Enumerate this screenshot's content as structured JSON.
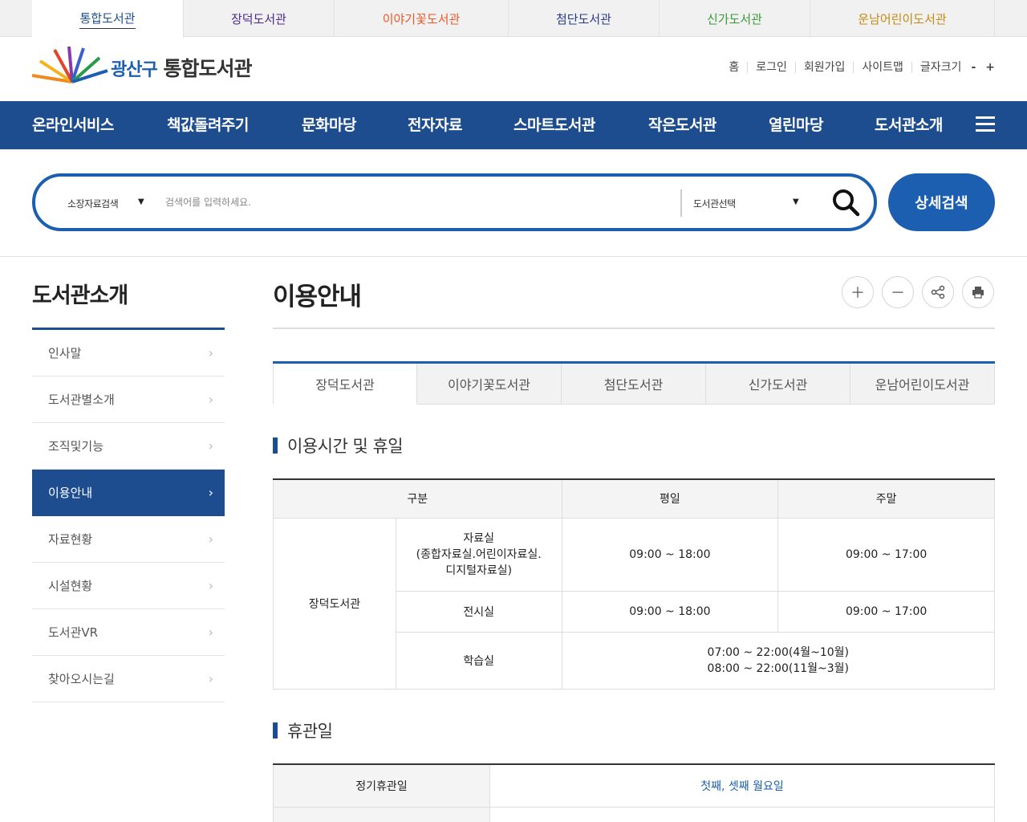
{
  "library_tabs": [
    {
      "label": "통합도서관",
      "color": "#1d4d8f"
    },
    {
      "label": "장덕도서관",
      "color": "#4b2a8c"
    },
    {
      "label": "이야기꽃도서관",
      "color": "#e85a2a"
    },
    {
      "label": "첨단도서관",
      "color": "#2a3a8c"
    },
    {
      "label": "신가도서관",
      "color": "#3a9a3a"
    },
    {
      "label": "운남어린이도서관",
      "color": "#c48a12"
    }
  ],
  "logo": {
    "prefix": "광산구",
    "name": "통합도서관"
  },
  "util_links": [
    "홈",
    "로그인",
    "회원가입",
    "사이트맵"
  ],
  "font_size": {
    "label": "글자크기",
    "minus": "-",
    "plus": "+"
  },
  "gnb": [
    "온라인서비스",
    "책값돌려주기",
    "문화마당",
    "전자자료",
    "스마트도서관",
    "작은도서관",
    "열린마당",
    "도서관소개"
  ],
  "search": {
    "type_selected": "소장자료검색",
    "placeholder": "검색어를 입력하세요.",
    "library_selected": "도서관선택",
    "advanced_label": "상세검색"
  },
  "sidebar": {
    "title": "도서관소개",
    "items": [
      "인사말",
      "도서관별소개",
      "조직및기능",
      "이용안내",
      "자료현황",
      "시설현황",
      "도서관VR",
      "찾아오시는길"
    ],
    "active_index": 3
  },
  "page": {
    "title": "이용안내"
  },
  "sub_tabs": [
    "장덕도서관",
    "이야기꽃도서관",
    "첨단도서관",
    "신가도서관",
    "운남어린이도서관"
  ],
  "hours_section": {
    "title": "이용시간 및 휴일",
    "headers": {
      "category": "구분",
      "weekday": "평일",
      "weekend": "주말"
    },
    "library": "장덕도서관",
    "rows": [
      {
        "room_line1": "자료실",
        "room_line2": "(종합자료실.어린이자료실.",
        "room_line3": "디지털자료실)",
        "weekday": "09:00 ~ 18:00",
        "weekend": "09:00 ~ 17:00"
      },
      {
        "room": "전시실",
        "weekday": "09:00 ~ 18:00",
        "weekend": "09:00 ~ 17:00"
      },
      {
        "room": "학습실",
        "hours_line1": "07:00 ~ 22:00(4월~10월)",
        "hours_line2": "08:00 ~ 22:00(11월~3월)"
      }
    ]
  },
  "closed_section": {
    "title": "휴관일",
    "label": "정기휴관일",
    "value": "첫째, 셋째 월요일"
  }
}
